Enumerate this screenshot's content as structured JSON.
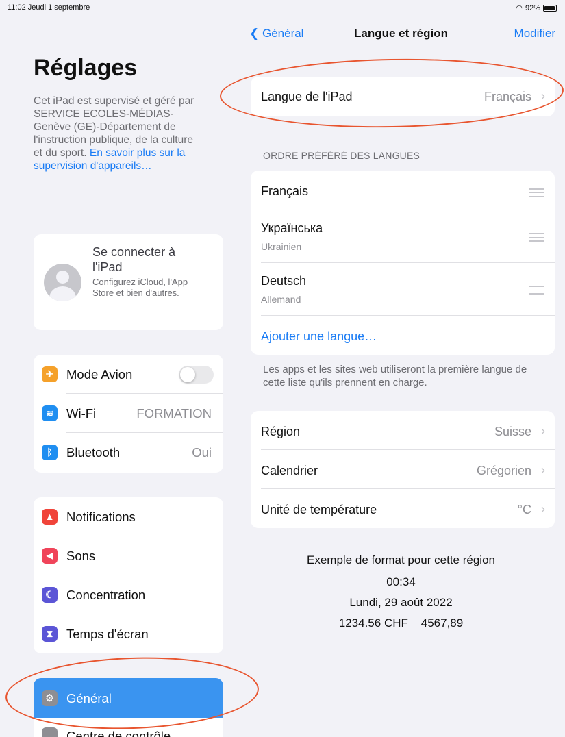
{
  "status_bar": {
    "time_date": "11:02  Jeudi 1 septembre",
    "battery": "92%"
  },
  "sidebar": {
    "title": "Réglages",
    "supervision_text": "Cet iPad est supervisé et géré par SERVICE ECOLES-MÉDIAS-Genève (GE)-Département de l'instruction publique, de la culture et du sport.",
    "supervision_link": "En savoir plus sur la supervision d'appareils…",
    "account": {
      "title": "Se connecter à l'iPad",
      "subtitle": "Configurez iCloud, l'App Store et bien d'autres."
    },
    "group1": [
      {
        "label": "Mode Avion",
        "icon": "airplane-icon",
        "color": "#f5a12a",
        "toggle": "off"
      },
      {
        "label": "Wi-Fi",
        "value": "FORMATION",
        "icon": "wifi-icon",
        "color": "#1f8ef1"
      },
      {
        "label": "Bluetooth",
        "value": "Oui",
        "icon": "bluetooth-icon",
        "color": "#1f8ef1"
      }
    ],
    "group2": [
      {
        "label": "Notifications",
        "icon": "bell-icon",
        "color": "#f0443a"
      },
      {
        "label": "Sons",
        "icon": "speaker-icon",
        "color": "#f0445a"
      },
      {
        "label": "Concentration",
        "icon": "moon-icon",
        "color": "#5b55d6"
      },
      {
        "label": "Temps d'écran",
        "icon": "hourglass-icon",
        "color": "#5b55d6"
      }
    ],
    "general": {
      "label": "Général",
      "icon": "gear-icon",
      "selected_color": "#3a94f0"
    },
    "partial_item": {
      "label": "Centre de contrôle",
      "icon": "control-center-icon"
    }
  },
  "detail": {
    "nav": {
      "back": "Général",
      "title": "Langue et région",
      "edit": "Modifier"
    },
    "ipad_language": {
      "label": "Langue de l'iPad",
      "value": "Français"
    },
    "languages_header": "ORDRE PRÉFÉRÉ DES LANGUES",
    "languages": [
      {
        "name": "Français",
        "subtitle": ""
      },
      {
        "name": "Українська",
        "subtitle": "Ukrainien"
      },
      {
        "name": "Deutsch",
        "subtitle": "Allemand"
      }
    ],
    "add_language": "Ajouter une langue…",
    "languages_footer": "Les apps et les sites web utiliseront la première langue de cette liste qu'ils prennent en charge.",
    "region_rows": [
      {
        "label": "Région",
        "value": "Suisse"
      },
      {
        "label": "Calendrier",
        "value": "Grégorien"
      },
      {
        "label": "Unité de température",
        "value": "°C"
      }
    ],
    "format_example": {
      "title": "Exemple de format pour cette région",
      "time": "00:34",
      "date": "Lundi, 29 août 2022",
      "numbers": "1234.56 CHF    4567,89"
    }
  },
  "annotations": {
    "circle_color": "#e8552f"
  }
}
